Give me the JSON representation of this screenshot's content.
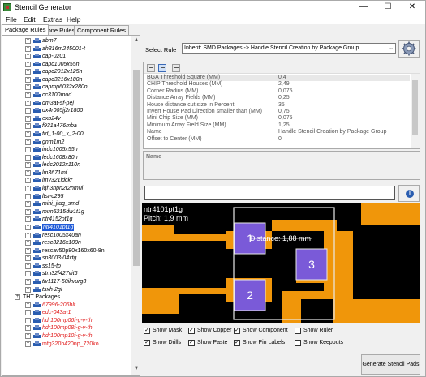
{
  "window": {
    "title": "Stencil Generator",
    "minimize": "—",
    "maximize": "☐",
    "close": "✕"
  },
  "menu": [
    "File",
    "Edit",
    "Extras",
    "Help"
  ],
  "tabs": [
    "Package Rules",
    "Zone Rules",
    "Component Rules"
  ],
  "tree": [
    {
      "label": "abm7",
      "style": "normal"
    },
    {
      "label": "ah316m245001-t",
      "style": "normal"
    },
    {
      "label": "cap-0201",
      "style": "normal"
    },
    {
      "label": "capc1005x55n",
      "style": "normal"
    },
    {
      "label": "capc2012x125n",
      "style": "normal"
    },
    {
      "label": "capc3216x180n",
      "style": "normal"
    },
    {
      "label": "capmp6032x280n",
      "style": "normal"
    },
    {
      "label": "cc3100mod",
      "style": "normal"
    },
    {
      "label": "dm3at-sf-pej",
      "style": "normal"
    },
    {
      "label": "dx4r005jj2r1800",
      "style": "normal"
    },
    {
      "label": "exb24v",
      "style": "normal"
    },
    {
      "label": "f931a476mba",
      "style": "normal"
    },
    {
      "label": "fid_1-00_x_2-00",
      "style": "normal"
    },
    {
      "label": "gnm1m2",
      "style": "normal"
    },
    {
      "label": "indc1005x55n",
      "style": "normal"
    },
    {
      "label": "ledc1608x80n",
      "style": "normal"
    },
    {
      "label": "ledc2012x110n",
      "style": "normal"
    },
    {
      "label": "lm3671mf",
      "style": "normal"
    },
    {
      "label": "lmv321idckr",
      "style": "normal"
    },
    {
      "label": "lqh3npn2r2nm0l",
      "style": "normal"
    },
    {
      "label": "ltst-c295",
      "style": "normal"
    },
    {
      "label": "mini_jtag_smd",
      "style": "normal"
    },
    {
      "label": "mun5215dw1t1g",
      "style": "normal"
    },
    {
      "label": "ntr4152pt1g",
      "style": "normal"
    },
    {
      "label": "ntr4101pt1g",
      "style": "selected"
    },
    {
      "label": "resc1005x40an",
      "style": "normal"
    },
    {
      "label": "resc3216x100n",
      "style": "normal"
    },
    {
      "label": "rescav50p80x160x60-8n",
      "style": "upright"
    },
    {
      "label": "sp3003-04xtg",
      "style": "normal"
    },
    {
      "label": "ss15-tp",
      "style": "normal"
    },
    {
      "label": "stm32f427vit6",
      "style": "normal"
    },
    {
      "label": "tlv1117-50ikvurg3",
      "style": "normal"
    },
    {
      "label": "tsxh-2gl",
      "style": "normal"
    },
    {
      "label": "THT Packages",
      "style": "category"
    },
    {
      "label": "67996-206hlf",
      "style": "red"
    },
    {
      "label": "edc-043a-1",
      "style": "red"
    },
    {
      "label": "hdr100mp06f-g-v-th",
      "style": "red"
    },
    {
      "label": "hdr100mp08f-g-v-th",
      "style": "red"
    },
    {
      "label": "hdr100mp10f-g-v-th",
      "style": "red"
    },
    {
      "label": "mfg320h420np_720ko",
      "style": "red-upright"
    }
  ],
  "rule": {
    "label": "Select Rule",
    "value": "Inherit:  SMD Packages -> Handle Stencil Creation by Package Group"
  },
  "properties": [
    {
      "name": "BGA Threshold Square (MM)",
      "value": "0,4"
    },
    {
      "name": "CHIP Threshold Houses (MM)",
      "value": "2,49"
    },
    {
      "name": "Corner Radius (MM)",
      "value": "0,075"
    },
    {
      "name": "Distance Array Fields (MM)",
      "value": "0,25"
    },
    {
      "name": "House distance cut size in Percent",
      "value": "35"
    },
    {
      "name": "Invert House Pad Direction smaller than (MM)",
      "value": "0,75"
    },
    {
      "name": "Mini Chip Size (MM)",
      "value": "0,075"
    },
    {
      "name": "Minimum Array Field Size (MM)",
      "value": "1,25"
    },
    {
      "name": "Name",
      "value": "Handle Stencil Creation by Package Group"
    },
    {
      "name": "Offset to Center (MM)",
      "value": "0"
    }
  ],
  "description_header": "Name",
  "preview": {
    "package_name": "ntr4101pt1g",
    "pitch": "Pitch: 1,9 mm",
    "distance": "Distance: 1,88 mm",
    "pads": [
      "1",
      "2",
      "3"
    ],
    "colors": {
      "copper": "#f0960a",
      "pad": "#7a5ad8",
      "background": "#000000"
    }
  },
  "checkboxes": [
    {
      "label": "Show Mask",
      "checked": true
    },
    {
      "label": "Show Copper",
      "checked": true
    },
    {
      "label": "Show Component",
      "checked": true
    },
    {
      "label": "Show Ruler",
      "checked": false
    },
    {
      "label": "Show Drills",
      "checked": true
    },
    {
      "label": "Show Paste",
      "checked": true
    },
    {
      "label": "Show Pin Labels",
      "checked": true
    },
    {
      "label": "Show Keepouts",
      "checked": false
    }
  ],
  "generate_button": "Generate Stencil Pads"
}
